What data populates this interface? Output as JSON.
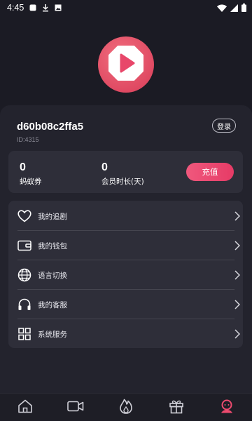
{
  "status_bar": {
    "time": "4:45",
    "icons": [
      "notification-square-icon",
      "download-icon",
      "image-icon",
      "wifi-icon",
      "signal-icon",
      "battery-icon"
    ]
  },
  "app": {
    "logo_icon": "play-logo-icon",
    "accent_color": "#e8476a"
  },
  "profile": {
    "username": "d60b08c2ffa5",
    "user_id": "ID:4315",
    "login_label": "登录"
  },
  "stats": {
    "coupons_value": "0",
    "coupons_label": "蚂蚁券",
    "vip_days_value": "0",
    "vip_days_label": "会员时长(天)",
    "recharge_label": "充值"
  },
  "menu": {
    "items": [
      {
        "label": "我的追剧",
        "icon": "heart-icon"
      },
      {
        "label": "我的钱包",
        "icon": "wallet-icon"
      },
      {
        "label": "语言切换",
        "icon": "globe-icon"
      },
      {
        "label": "我的客服",
        "icon": "headphones-icon"
      },
      {
        "label": "系统服务",
        "icon": "grid-icon"
      }
    ]
  },
  "bottom_nav": {
    "items": [
      {
        "icon": "home-icon",
        "active": false
      },
      {
        "icon": "video-camera-icon",
        "active": false
      },
      {
        "icon": "flame-icon",
        "active": false
      },
      {
        "icon": "gift-icon",
        "active": false
      },
      {
        "icon": "profile-icon",
        "active": true
      }
    ]
  }
}
